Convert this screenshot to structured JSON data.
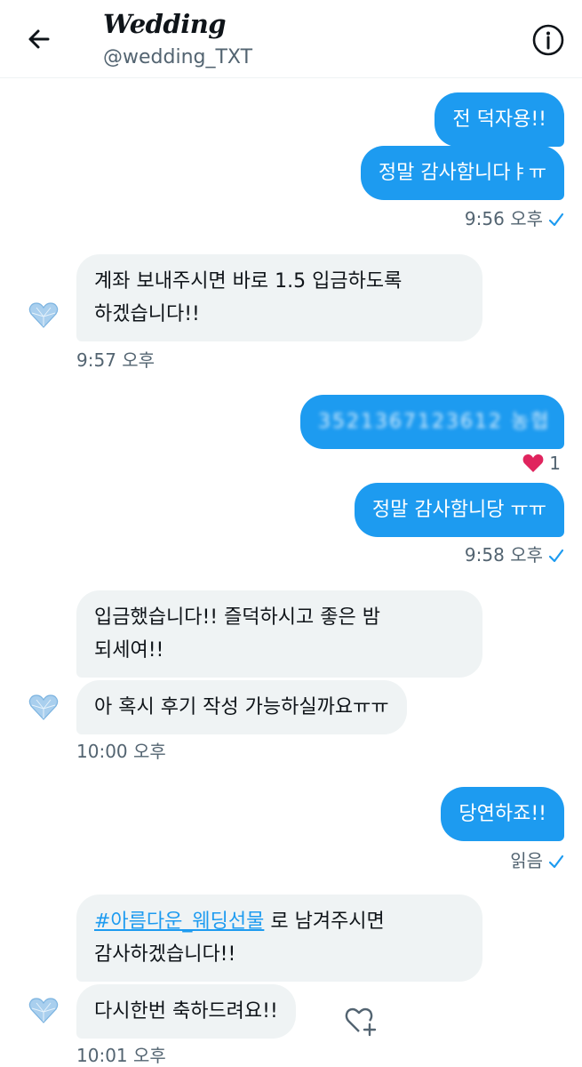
{
  "header": {
    "title": "Wedding",
    "handle": "@wedding_TXT"
  },
  "messages": {
    "m1": "전 덕자용!!",
    "m2": "정말 감사함니다ㅑㅠ",
    "t1": "9:56 오후",
    "m3_line1": "계좌 보내주시면 바로 1.5 입금하도록",
    "m3_line2": "하겠습니다!!",
    "t2": "9:57 오후",
    "m4_blurred": "3521367123612 농협",
    "m4_reaction_count": "1",
    "m5": "정말 감사함니당 ㅠㅠ",
    "t3": "9:58 오후",
    "m6_line1": "입금했습니다!! 즐덕하시고 좋은 밤",
    "m6_line2": "되세여!!",
    "m7": "아 혹시 후기 작성 가능하실까요ㅠㅠ",
    "t4": "10:00 오후",
    "m8": "당연하죠!!",
    "t5": "읽음",
    "m9_hashtag": "#아름다운_웨딩선물",
    "m9_rest": " 로 남겨주시면",
    "m9_line2": "감사하겠습니다!!",
    "m10": "다시한번 축하드려요!!",
    "t6": "10:01 오후"
  },
  "colors": {
    "accent": "#1d9bf0",
    "incoming_bubble": "#eff3f4",
    "like_heart": "#e0245e"
  }
}
